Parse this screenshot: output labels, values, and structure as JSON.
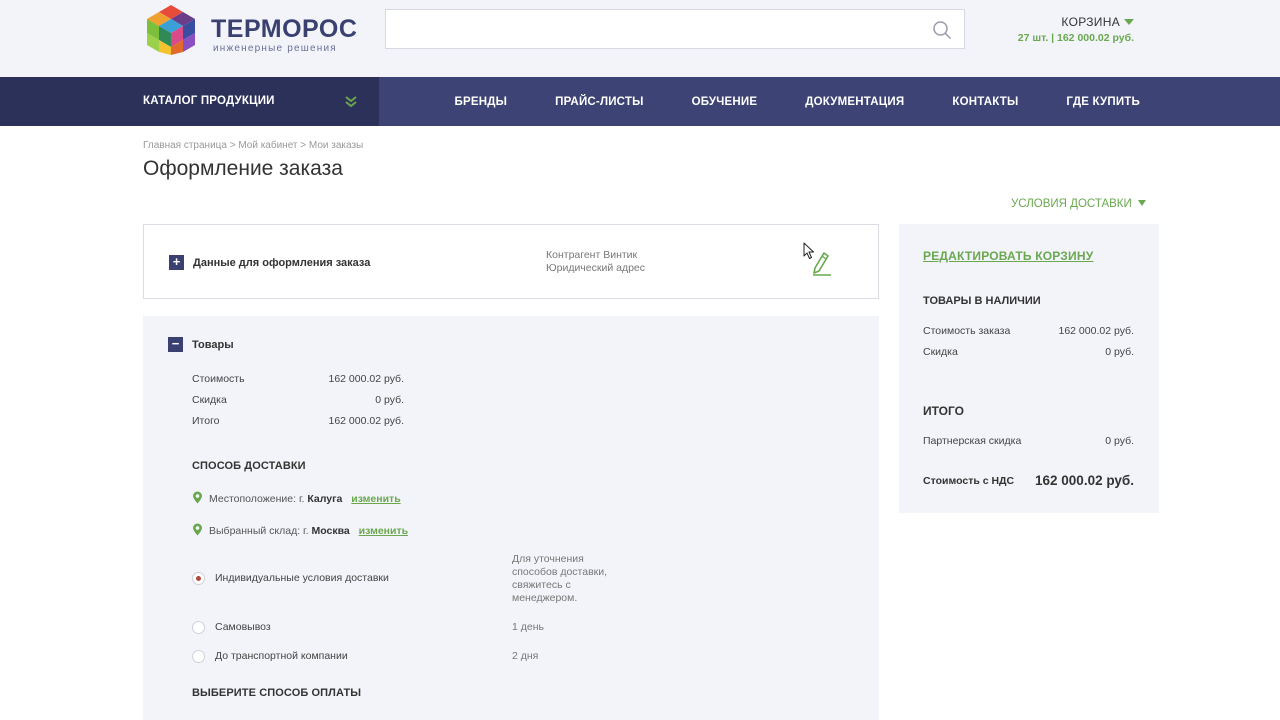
{
  "header": {
    "logo_name": "ТЕРМОРОС",
    "logo_sub": "инженерные решения",
    "search_placeholder": "",
    "cart_title": "КОРЗИНА",
    "cart_summary": "27 шт. | 162 000.02 руб."
  },
  "nav": {
    "catalog": "КАТАЛОГ ПРОДУКЦИИ",
    "items": [
      "БРЕНДЫ",
      "ПРАЙС-ЛИСТЫ",
      "ОБУЧЕНИЕ",
      "ДОКУМЕНТАЦИЯ",
      "КОНТАКТЫ",
      "ГДЕ КУПИТЬ"
    ]
  },
  "breadcrumb": "Главная страница  >  Мой кабинет  >  Мои заказы",
  "page_title": "Оформление заказа",
  "delivery_terms": "УСЛОВИЯ ДОСТАВКИ",
  "order_data": {
    "toggle": "+",
    "title": "Данные для оформления заказа",
    "line1": "Контрагент Винтик",
    "line2": "Юридический адрес"
  },
  "goods": {
    "toggle": "−",
    "title": "Товары",
    "rows": [
      {
        "label": "Стоимость",
        "value": "162 000.02 руб."
      },
      {
        "label": "Скидка",
        "value": "0 руб."
      },
      {
        "label": "Итого",
        "value": "162 000.02 руб."
      }
    ],
    "delivery_heading": "СПОСОБ ДОСТАВКИ",
    "location_label": "Местоположение: г.",
    "location_city": "Калуга",
    "location_change": "изменить",
    "warehouse_label": "Выбранный склад: г.",
    "warehouse_city": "Москва",
    "warehouse_change": "изменить",
    "options": [
      {
        "label": "Индивидуальные условия доставки",
        "note": "Для уточнения способов доставки, свяжитесь с менеджером.",
        "selected": true
      },
      {
        "label": "Самовывоз",
        "note": "1 день",
        "selected": false
      },
      {
        "label": "До транспортной компании",
        "note": "2 дня",
        "selected": false
      }
    ],
    "payment_heading": "ВЫБЕРИТЕ СПОСОБ ОПЛАТЫ"
  },
  "sidebar": {
    "edit_cart": "РЕДАКТИРОВАТЬ КОРЗИНУ",
    "in_stock_heading": "ТОВАРЫ В НАЛИЧИИ",
    "order_cost_label": "Стоимость заказа",
    "order_cost_value": "162 000.02 руб.",
    "discount_label": "Скидка",
    "discount_value": "0 руб.",
    "total_heading": "ИТОГО",
    "partner_discount_label": "Партнерская скидка",
    "partner_discount_value": "0 руб.",
    "vat_total_label": "Стоимость с НДС",
    "vat_total_value": "162 000.02 руб."
  },
  "colors": {
    "brand_dark": "#2c3159",
    "brand": "#3d4374",
    "accent_green": "#6aa84f",
    "panel_bg": "#f3f4fa"
  }
}
